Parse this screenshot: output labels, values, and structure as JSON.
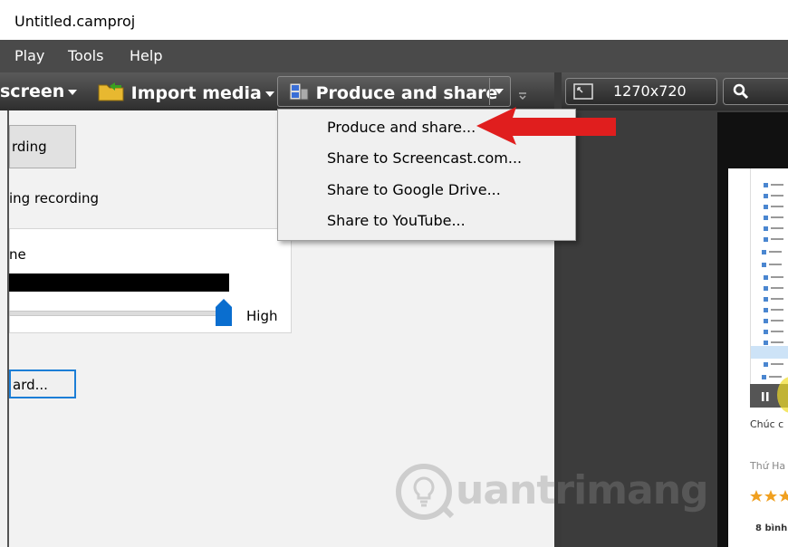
{
  "window": {
    "title": "Untitled.camproj"
  },
  "menu": {
    "items": [
      "Play",
      "Tools",
      "Help"
    ]
  },
  "toolbar": {
    "record_screen": "screen",
    "import_media": "Import media",
    "produce_share": "Produce and share"
  },
  "dropdown": {
    "items": [
      "Produce and share...",
      "Share to Screencast.com...",
      "Share to Google Drive...",
      "Share to YouTube..."
    ]
  },
  "left_panel": {
    "record_button": "rding",
    "during_recording": "ing recording",
    "volume_label": "ne",
    "slider_high": "High",
    "wizard_button": "ard..."
  },
  "right_toolbar": {
    "resolution": "1270x720"
  },
  "preview": {
    "caption": "Chúc c",
    "author": "Thứ Ha",
    "rating_count": "8 bình"
  },
  "watermark": {
    "text": "uantrimang"
  },
  "colors": {
    "accent_red": "#e01e1e",
    "slider_blue": "#0a6ecf",
    "focus_blue": "#1c7ed6"
  }
}
